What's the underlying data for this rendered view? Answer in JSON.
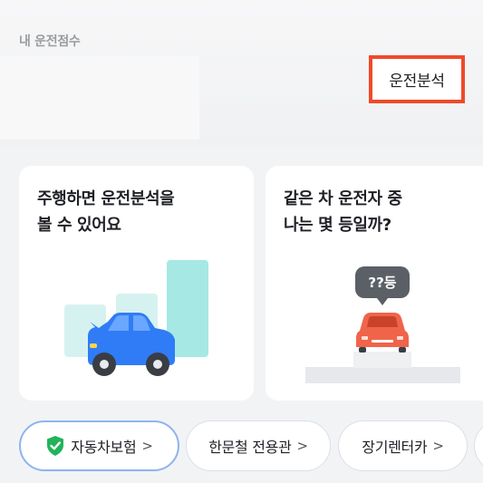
{
  "header": {
    "section_title": "내 운전점수",
    "analysis_button": "운전분석"
  },
  "cards": [
    {
      "line1": "주행하면 운전분석을",
      "line2": "볼 수 있어요"
    },
    {
      "line1": "같은 차 운전자 중",
      "line2": "나는 몇 등일까?",
      "bubble": "??등"
    }
  ],
  "chips": [
    {
      "label": "자동차보험",
      "icon": "shield-check-icon",
      "chevron": ">"
    },
    {
      "label": "한문철 전용관",
      "chevron": ">"
    },
    {
      "label": "장기렌터카",
      "chevron": ">"
    }
  ],
  "colors": {
    "highlight_border": "#ef4a2a",
    "car_blue": "#2f7cf6",
    "car_red": "#f0644a",
    "bar_teal": "#a6e8e3",
    "shield_green": "#22b35c"
  }
}
